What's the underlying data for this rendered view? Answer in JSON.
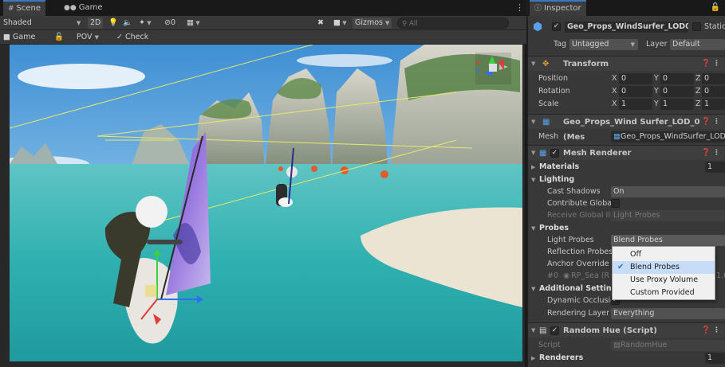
{
  "scene_tabs": {
    "scene_label": "Scene",
    "game_label": "Game"
  },
  "scene_toolbar": {
    "shading_mode": "Shaded",
    "toggle_2d": "2D",
    "fx_count": "0",
    "gizmos_label": "Gizmos",
    "search_placeholder": "All"
  },
  "game_toolbar": {
    "game_label": "Game",
    "camera_label": "POV",
    "check_label": "Check"
  },
  "scene_gizmo": {
    "y_axis": "y",
    "x_axis": "x",
    "z_axis": "z"
  },
  "inspector": {
    "tab_label": "Inspector",
    "object_name": "Geo_Props_WindSurfer_LOD0",
    "static_label": "Static",
    "tag_label": "Tag",
    "tag_value": "Untagged",
    "layer_label": "Layer",
    "layer_value": "Default",
    "transform": {
      "title": "Transform",
      "rows": [
        {
          "label": "Position",
          "x": "0",
          "y": "0",
          "z": "0"
        },
        {
          "label": "Rotation",
          "x": "0",
          "y": "0",
          "z": "0"
        },
        {
          "label": "Scale",
          "x": "1",
          "y": "1",
          "z": "1"
        }
      ],
      "axis_x": "X",
      "axis_y": "Y",
      "axis_z": "Z"
    },
    "mesh_filter": {
      "title": "Geo_Props_Wind Surfer_LOD_0 (Mes",
      "mesh_label": "Mesh",
      "mesh_value": "Geo_Props_WindSurfer_LOD_"
    },
    "mesh_renderer": {
      "title": "Mesh Renderer",
      "materials_label": "Materials",
      "materials_count": "1",
      "lighting_label": "Lighting",
      "cast_shadows_label": "Cast Shadows",
      "cast_shadows_value": "On",
      "contribute_gi_label": "Contribute Global",
      "receive_gi_label": "Receive Global Illu",
      "receive_gi_value": "Light Probes",
      "probes_label": "Probes",
      "light_probes_label": "Light Probes",
      "light_probes_value": "Blend Probes",
      "reflection_probes_label": "Reflection Probes",
      "anchor_override_label": "Anchor Override",
      "probe_index": "#0",
      "probe_name": "RP_Sea (R",
      "probe_weight": "1.0",
      "additional_label": "Additional Settings",
      "dynamic_occlusion_label": "Dynamic Occlusic",
      "rendering_layer_label": "Rendering Layer M",
      "rendering_layer_value": "Everything"
    },
    "random_hue": {
      "title": "Random Hue (Script)",
      "script_label": "Script",
      "script_value": "RandomHue",
      "renderers_label": "Renderers",
      "renderers_count": "1"
    }
  },
  "light_probes_popup": {
    "options": [
      "Off",
      "Blend Probes",
      "Use Proxy Volume",
      "Custom Provided"
    ],
    "selected_index": 1
  },
  "colors": {
    "accent_blue": "#3a79bb",
    "panel_bg": "#383838",
    "selection_bg": "#c6dcf7"
  }
}
